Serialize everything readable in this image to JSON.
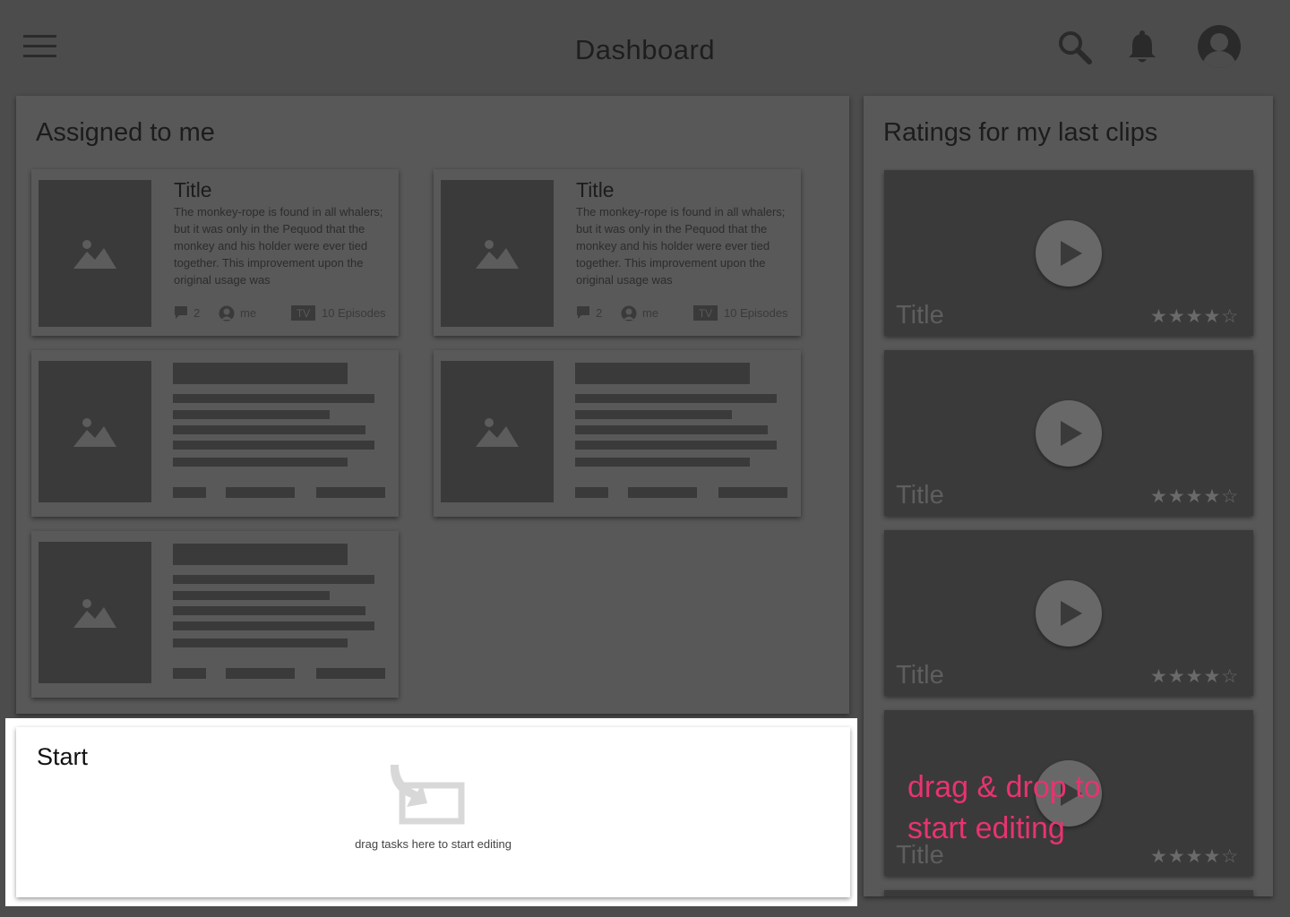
{
  "header": {
    "title": "Dashboard",
    "menu_icon": "hamburger-menu-icon",
    "search_icon": "search-icon",
    "notifications_icon": "bell-icon",
    "avatar_icon": "user-avatar-icon"
  },
  "assigned": {
    "title": "Assigned to me",
    "cards": [
      {
        "title": "Title",
        "description": "The monkey-rope is found in all whalers; but it was only in the Pequod that the monkey and his holder were ever tied together. This improvement upon the original usage was",
        "comments": "2",
        "assignee": "me",
        "type_badge": "TV",
        "episodes": "10 Episodes"
      },
      {
        "title": "Title",
        "description": "The monkey-rope is found in all whalers; but it was only in the Pequod that the monkey and his holder were ever tied together. This improvement upon the original usage was",
        "comments": "2",
        "assignee": "me",
        "type_badge": "TV",
        "episodes": "10 Episodes"
      }
    ]
  },
  "ratings": {
    "title": "Ratings for my last clips",
    "clips": [
      {
        "title": "Title",
        "rating": 4,
        "max_rating": 5,
        "stars": "★★★★☆"
      },
      {
        "title": "Title",
        "rating": 4,
        "max_rating": 5,
        "stars": "★★★★☆"
      },
      {
        "title": "Title",
        "rating": 4,
        "max_rating": 5,
        "stars": "★★★★☆"
      },
      {
        "title": "Title",
        "rating": 4,
        "max_rating": 5,
        "stars": "★★★★☆"
      }
    ]
  },
  "start": {
    "title": "Start",
    "drop_hint": "drag tasks here to start editing"
  },
  "annotation": {
    "line1": "drag & drop to",
    "line2": "start editing",
    "color": "#e8336f"
  },
  "colors": {
    "background": "#4c4c4c",
    "panel": "#585858",
    "placeholder": "#3a3a3a",
    "highlight_panel": "#ffffff"
  }
}
